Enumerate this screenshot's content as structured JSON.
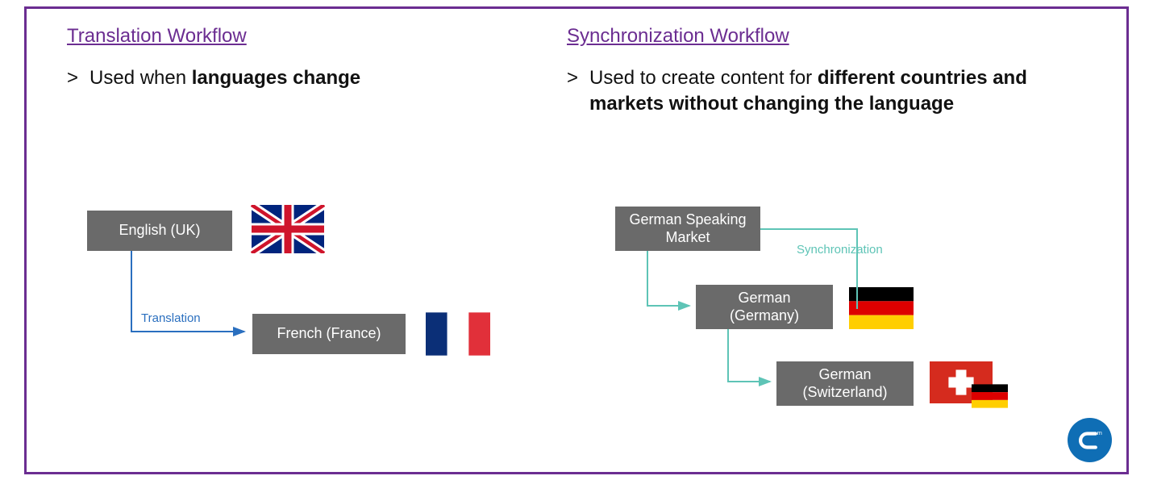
{
  "left": {
    "title": "Translation Workflow",
    "bullet_pre": "Used when ",
    "bullet_bold": "languages change",
    "node1": "English (UK)",
    "node2": "French (France)",
    "arrow_label": "Translation"
  },
  "right": {
    "title": "Synchronization Workflow",
    "bullet_pre": "Used to create content for ",
    "bullet_bold": "different countries and markets without changing the language",
    "node1": "German Speaking Market",
    "node2": "German (Germany)",
    "node3": "German (Switzerland)",
    "arrow_label": "Synchronization"
  },
  "colors": {
    "purple": "#6b2d91",
    "node_bg": "#6a6a6a",
    "blue": "#2a6fbf",
    "teal": "#5ec4b6"
  }
}
